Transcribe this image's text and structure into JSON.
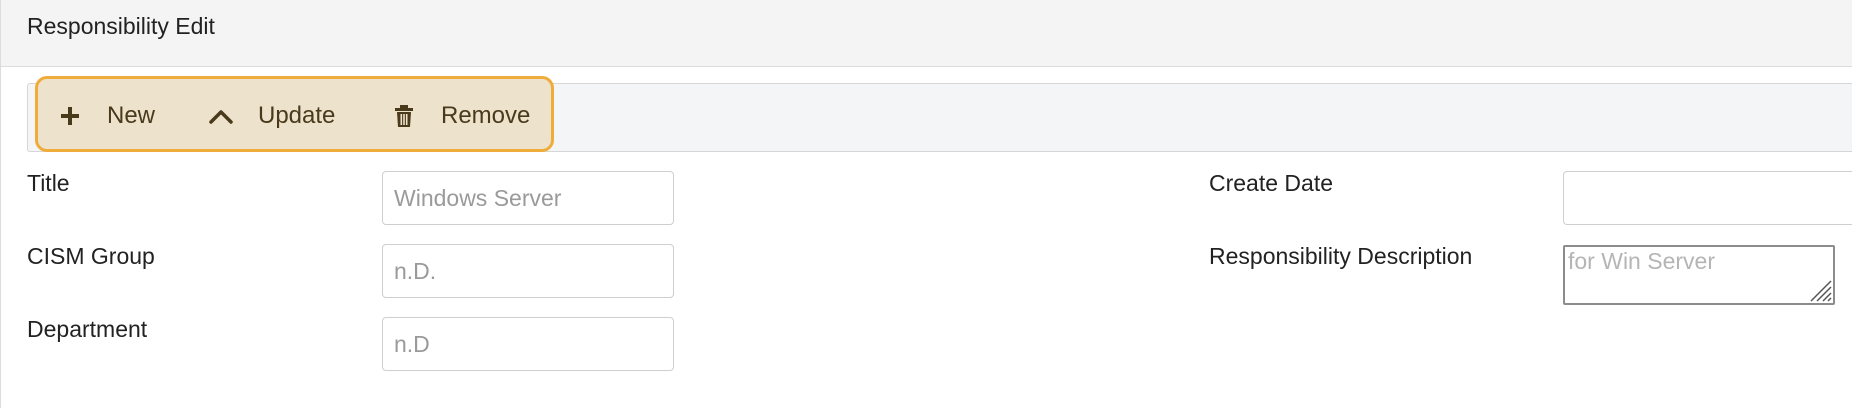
{
  "panel": {
    "title": "Responsibility Edit"
  },
  "toolbar": {
    "new_label": "New",
    "update_label": "Update",
    "remove_label": "Remove",
    "highlight_color": "#efac3a"
  },
  "fields": {
    "title": {
      "label": "Title",
      "value": "Windows Server"
    },
    "cism_group": {
      "label": "CISM Group",
      "value": "n.D."
    },
    "department": {
      "label": "Department",
      "value": "n.D"
    },
    "create_date": {
      "label": "Create Date",
      "value": ""
    },
    "description": {
      "label": "Responsibility Description",
      "value": "for Win Server"
    }
  }
}
